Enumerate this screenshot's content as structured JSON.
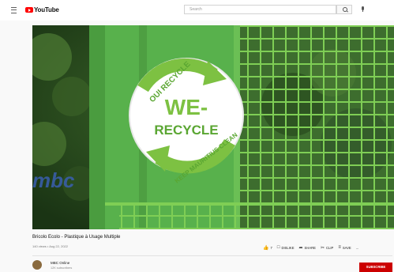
{
  "header": {
    "logo_text": "YouTube",
    "search_placeholder": "Search"
  },
  "video": {
    "title": "Bricolo Ecolo - Plastique à Usage Multiple",
    "meta": "140 views • Aug 22, 2022",
    "thumbnail": {
      "sign_top_arc": "OUI RECYCLE",
      "sign_main_line1": "WE-",
      "sign_main_line2": "RECYCLE",
      "sign_bottom_arc": "KEEP MAURITIUS CLEAN",
      "bin_logo": "mbc"
    }
  },
  "actions": {
    "like_count": "7",
    "dislike": "DISLIKE",
    "share": "SHARE",
    "clip": "CLIP",
    "save": "SAVE",
    "more": "..."
  },
  "channel": {
    "name": "MBC Online",
    "subscribers": "12K subscribers",
    "subscribe_label": "SUBSCRIBE"
  },
  "colors": {
    "brand_red": "#ff0000",
    "subscribe_red": "#cc0000",
    "bin_green": "#58b14c",
    "recycle_green": "#7dc142"
  },
  "icons": [
    "menu-icon",
    "youtube-logo-icon",
    "search-icon",
    "mic-icon",
    "thumbs-up-icon",
    "dislike-icon",
    "share-icon",
    "clip-icon",
    "save-icon",
    "more-icon"
  ]
}
